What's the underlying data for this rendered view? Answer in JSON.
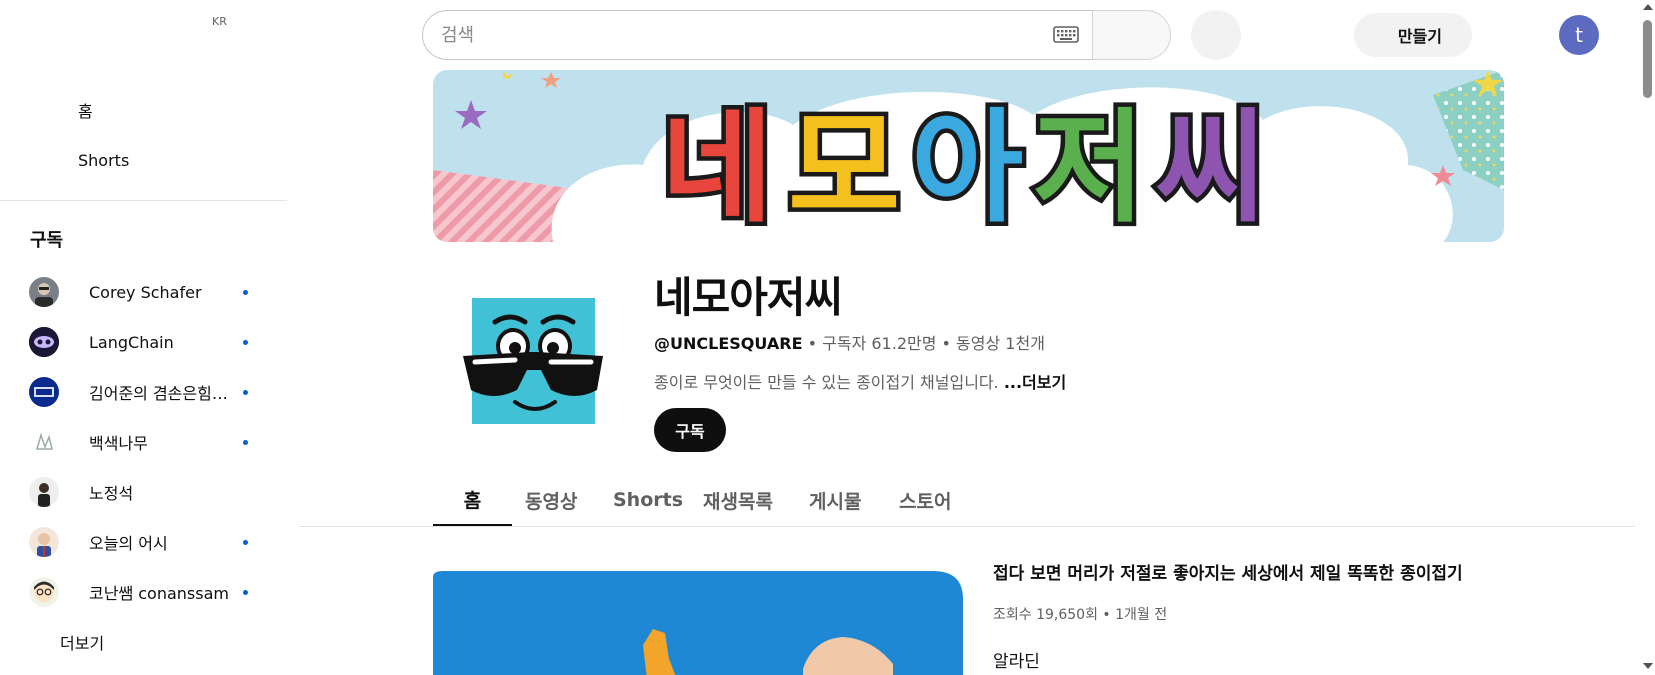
{
  "header": {
    "country_code": "KR",
    "search_placeholder": "검색",
    "create_label": "만들기",
    "user_initial": "t"
  },
  "sidebar": {
    "nav": [
      {
        "label": "홈",
        "icon": "home-icon"
      },
      {
        "label": "Shorts",
        "icon": "shorts-icon"
      }
    ],
    "subscriptions_title": "구독",
    "subscriptions": [
      {
        "label": "Corey Schafer",
        "live_dot": true
      },
      {
        "label": "LangChain",
        "live_dot": true
      },
      {
        "label": "김어준의 겸손은힘들다 뉴스공장",
        "live_dot": true
      },
      {
        "label": "백색나무",
        "live_dot": true
      },
      {
        "label": "노정석",
        "live_dot": false
      },
      {
        "label": "오늘의 어시",
        "live_dot": true
      },
      {
        "label": "코난쌤 conanssam",
        "live_dot": true
      }
    ],
    "more_label": "더보기"
  },
  "channel": {
    "banner_text": "네모아저씨",
    "name": "네모아저씨",
    "handle": "@UNCLESQUARE",
    "meta_rest": " • 구독자 61.2만명 • 동영상 1천개",
    "description": "종이로 무엇이든 만들 수 있는 종이접기 채널입니다. ",
    "more_label": "...더보기",
    "subscribe_label": "구독"
  },
  "tabs": [
    {
      "label": "홈",
      "active": true
    },
    {
      "label": "동영상",
      "active": false
    },
    {
      "label": "Shorts",
      "active": false
    },
    {
      "label": "재생목록",
      "active": false
    },
    {
      "label": "게시물",
      "active": false
    },
    {
      "label": "스토어",
      "active": false
    }
  ],
  "featured_video": {
    "title": "접다 보면 머리가 저절로 좋아지는 세상에서 제일 똑똑한 종이접기",
    "stats": "조회수 19,650회 • 1개월 전",
    "description": "알라딘"
  },
  "colors": {
    "accent_blue": "#065fd4",
    "user_avatar_bg": "#5c6bc0",
    "subscribe_bg": "#0f0f0f"
  }
}
